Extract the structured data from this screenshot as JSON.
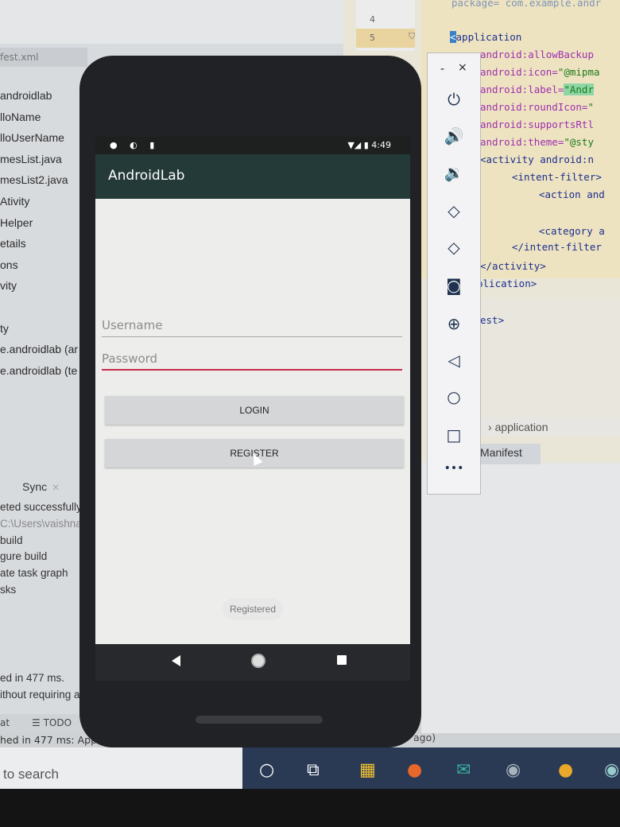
{
  "ide": {
    "file_tab": "fest.xml",
    "project_tree": [
      "androidlab",
      "lloName",
      "lloUserName",
      "mesList.java",
      "mesList2.java",
      "Ativity",
      "Helper",
      "etails",
      "ons",
      "vity",
      "",
      "ty",
      "e.androidlab (ar",
      "e.androidlab (te"
    ],
    "sync_tab": "Sync",
    "build_output": [
      "eted successfully",
      "C:\\Users\\vaishna",
      "build",
      "gure build",
      "ate task graph",
      "sks"
    ],
    "build_bottom": [
      "ed in 477 ms.",
      "ithout requiring a"
    ],
    "status_left": "at",
    "status_todo": "TODO",
    "status_message": "hed in 477 ms: App",
    "status_right": "ago)",
    "gutter_lines": [
      "4",
      "5"
    ],
    "code": {
      "top_partial": "package= com.example.andr",
      "application": "application",
      "attrs": [
        {
          "attr": "android:allowBackup",
          "val": ""
        },
        {
          "attr": "android:icon=",
          "val": "\"@mipma"
        },
        {
          "attr": "android:label=",
          "val": "\"Andr"
        },
        {
          "attr": "android:roundIcon=",
          "val": "\""
        },
        {
          "attr": "android:supportsRtl",
          "val": ""
        },
        {
          "attr": "android:theme=",
          "val": "\"@sty"
        }
      ],
      "activity": "<activity android:n",
      "intent_filter": "<intent-filter>",
      "action": "<action and",
      "category": "<category a",
      "intent_filter_close": "</intent-filter",
      "activity_close": "</activity>",
      "application_close": "plication>",
      "manifest_close": "est>"
    },
    "breadcrumb": "application",
    "manifest_tab": "Manifest"
  },
  "emulator_toolbar": {
    "minimize": "-",
    "close": "×",
    "buttons": [
      "power-icon",
      "volume-up-icon",
      "volume-down-icon",
      "rotate-left-icon",
      "rotate-right-icon",
      "camera-icon",
      "zoom-icon",
      "back-icon",
      "home-icon",
      "overview-icon",
      "more-icon"
    ]
  },
  "phone": {
    "status_time": "4:49",
    "app_title": "AndroidLab",
    "username_hint": "Username",
    "password_hint": "Password",
    "login_label": "LOGIN",
    "register_label": "REGISTER",
    "toast": "Registered"
  },
  "taskbar": {
    "search_placeholder": "to search"
  }
}
